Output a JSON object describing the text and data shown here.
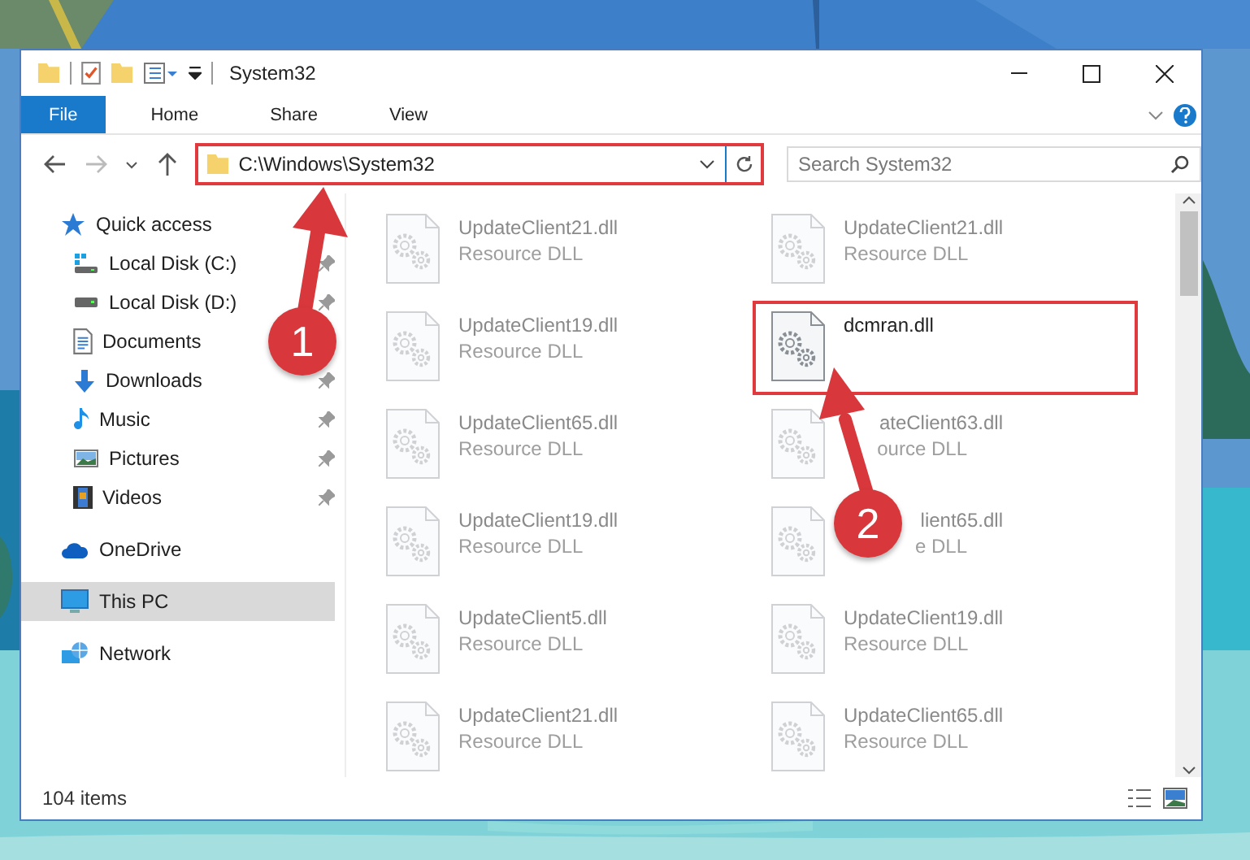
{
  "window": {
    "title": "System32"
  },
  "ribbon_tabs": [
    {
      "label": "File",
      "selected": true
    },
    {
      "label": "Home",
      "selected": false
    },
    {
      "label": "Share",
      "selected": false
    },
    {
      "label": "View",
      "selected": false
    }
  ],
  "address": {
    "path": "C:\\Windows\\System32",
    "highlighted": true
  },
  "search": {
    "placeholder": "Search System32"
  },
  "sidebar": {
    "items": [
      {
        "label": "Quick access",
        "kind": "star",
        "selected": false,
        "children": [
          {
            "label": "Local Disk (C:)",
            "kind": "system-drive",
            "pinned": true,
            "selected": false
          },
          {
            "label": "Local Disk (D:)",
            "kind": "drive",
            "pinned": true,
            "selected": false
          },
          {
            "label": "Documents",
            "kind": "documents",
            "selected": false
          },
          {
            "label": "Downloads",
            "kind": "downloads",
            "pinned": true,
            "selected": false
          },
          {
            "label": "Music",
            "kind": "music",
            "pinned": true,
            "selected": false
          },
          {
            "label": "Pictures",
            "kind": "pictures",
            "pinned": true,
            "selected": false
          },
          {
            "label": "Videos",
            "kind": "videos",
            "pinned": true,
            "selected": false
          }
        ]
      },
      {
        "label": "OneDrive",
        "kind": "cloud",
        "selected": false
      },
      {
        "label": "This PC",
        "kind": "pc",
        "selected": true
      },
      {
        "label": "Network",
        "kind": "network",
        "selected": false
      }
    ]
  },
  "files": [
    {
      "name": "UpdateClient21.dll",
      "type": "Resource DLL",
      "kind": "blurred",
      "highlighted": false
    },
    {
      "name": "UpdateClient21.dll",
      "type": "Resource DLL",
      "kind": "blurred",
      "highlighted": false
    },
    {
      "name": "UpdateClient19.dll",
      "type": "Resource DLL",
      "kind": "blurred",
      "highlighted": false
    },
    {
      "name": "dcmran.dll",
      "kind": "plain",
      "highlighted": true
    },
    {
      "name": "UpdateClient65.dll",
      "type": "Resource DLL",
      "kind": "blurred",
      "highlighted": false
    },
    {
      "name": "ateClient63.dll",
      "type": "ource DLL",
      "kind": "covered",
      "highlighted": false
    },
    {
      "name": "UpdateClient19.dll",
      "type": "Resource DLL",
      "kind": "blurred",
      "highlighted": false
    },
    {
      "name": "lient65.dll",
      "type": "e DLL",
      "kind": "covered",
      "highlighted": false
    },
    {
      "name": "UpdateClient5.dll",
      "type": "Resource DLL",
      "kind": "blurred",
      "highlighted": false
    },
    {
      "name": "UpdateClient19.dll",
      "type": "Resource DLL",
      "kind": "blurred",
      "highlighted": false
    },
    {
      "name": "UpdateClient21.dll",
      "type": "Resource DLL",
      "kind": "blurred",
      "highlighted": false
    },
    {
      "name": "UpdateClient65.dll",
      "type": "Resource DLL",
      "kind": "blurred",
      "highlighted": false
    }
  ],
  "status_bar": {
    "count": "104 items"
  },
  "annotations": [
    {
      "number": "1"
    },
    {
      "number": "2"
    }
  ]
}
